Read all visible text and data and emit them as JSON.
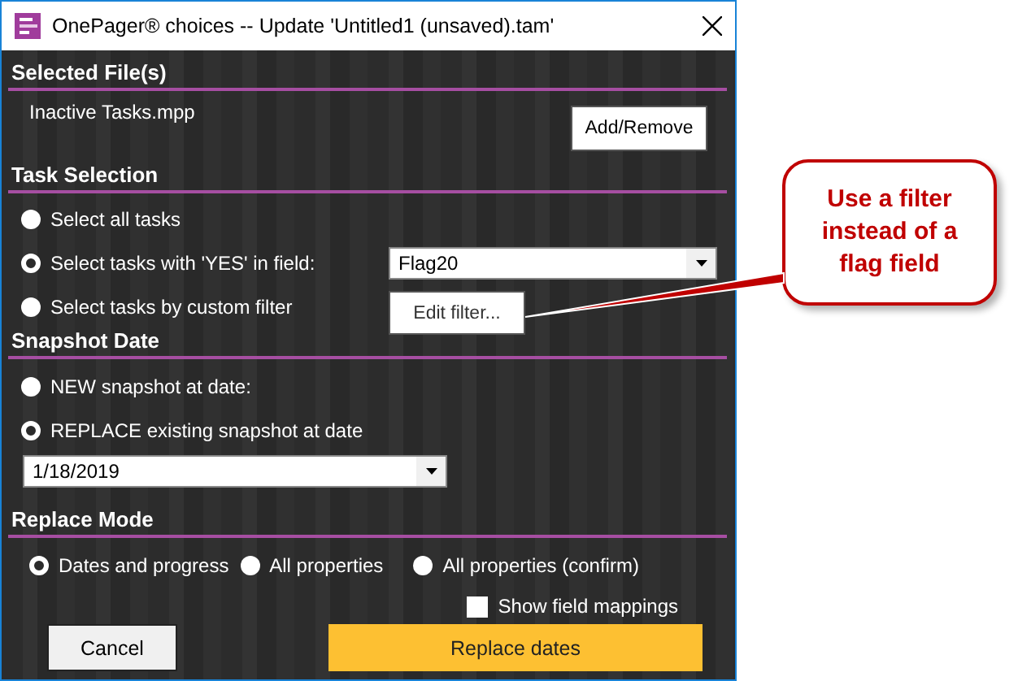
{
  "window": {
    "title": "OnePager® choices -- Update 'Untitled1 (unsaved).tam'"
  },
  "selected_files": {
    "heading": "Selected File(s)",
    "file": "Inactive Tasks.mpp",
    "button": "Add/Remove"
  },
  "task_selection": {
    "heading": "Task Selection",
    "options": [
      {
        "label": "Select all tasks",
        "selected": false
      },
      {
        "label": "Select tasks with 'YES' in field:",
        "selected": true
      },
      {
        "label": "Select tasks by custom filter",
        "selected": false
      }
    ],
    "field_dropdown": {
      "value": "Flag20"
    },
    "edit_filter_button": "Edit filter..."
  },
  "snapshot_date": {
    "heading": "Snapshot Date",
    "options": [
      {
        "label": "NEW snapshot at date:",
        "selected": false
      },
      {
        "label": "REPLACE existing snapshot at date",
        "selected": true
      }
    ],
    "date_dropdown": {
      "value": "1/18/2019"
    }
  },
  "replace_mode": {
    "heading": "Replace Mode",
    "options": [
      {
        "label": "Dates and progress",
        "selected": true
      },
      {
        "label": "All properties",
        "selected": false
      },
      {
        "label": "All properties (confirm)",
        "selected": false
      }
    ],
    "show_field_mappings": {
      "label": "Show field mappings",
      "checked": false
    }
  },
  "buttons": [
    {
      "label": "Cancel",
      "kind": "secondary"
    },
    {
      "label": "Replace dates",
      "kind": "primary"
    }
  ],
  "callout": {
    "text": "Use a filter instead of a flag field"
  }
}
